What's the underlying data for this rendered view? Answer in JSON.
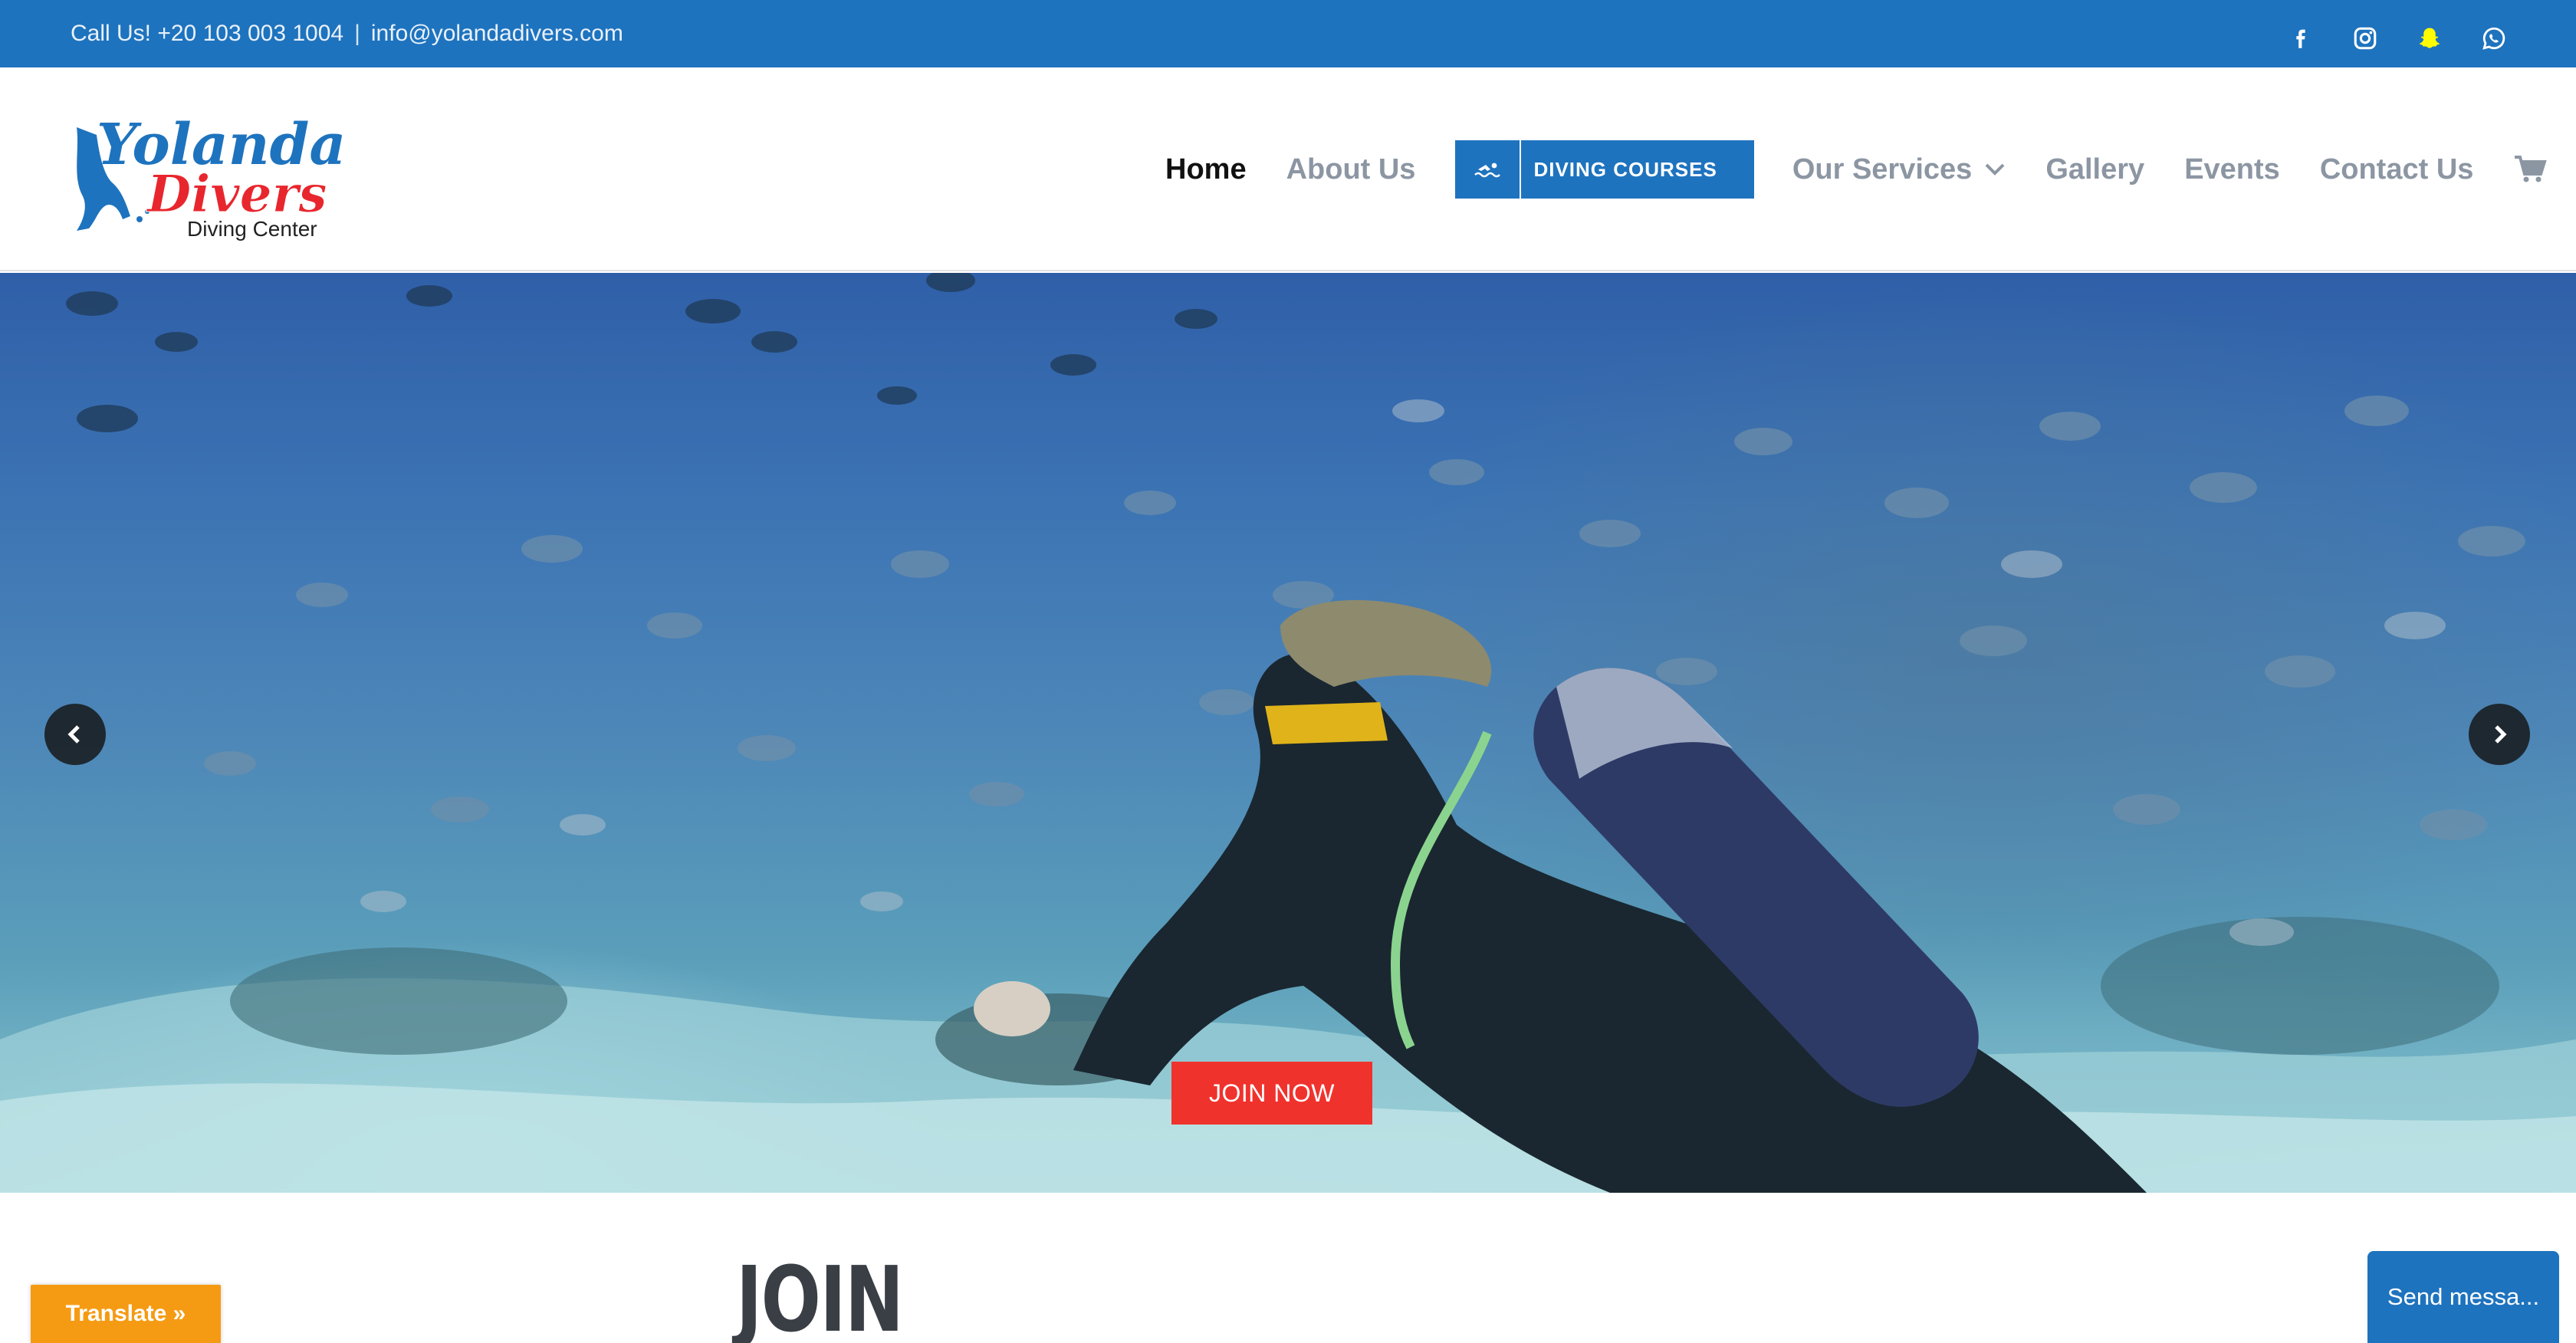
{
  "topbar": {
    "call_text": "Call Us! +20 103 003 1004",
    "separator": "|",
    "email": "info@yolandadivers.com",
    "social": [
      "facebook-icon",
      "instagram-icon",
      "snapchat-icon",
      "whatsapp-icon"
    ]
  },
  "logo": {
    "line1": "Yolanda",
    "line2": "Divers",
    "line3": "Diving Center"
  },
  "nav": {
    "home": "Home",
    "about": "About Us",
    "courses": "DIVING COURSES",
    "services": "Our Services",
    "gallery": "Gallery",
    "events": "Events",
    "contact": "Contact Us"
  },
  "hero": {
    "cta": "JOIN NOW"
  },
  "section": {
    "title": "JOIN"
  },
  "widgets": {
    "translate": "Translate »",
    "send_message": "Send messa..."
  },
  "colors": {
    "brand_blue": "#1e73be",
    "cta_red": "#f0322d",
    "translate_orange": "#f59b13",
    "nav_gray": "#8c96a3"
  }
}
